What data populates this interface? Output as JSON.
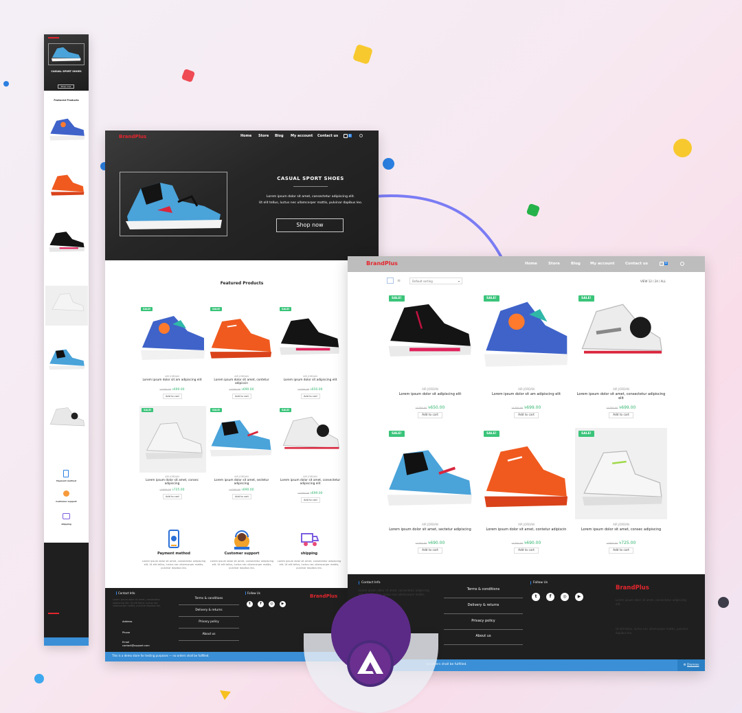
{
  "brand": {
    "name": "BrandPlus",
    "color": "#e4262d"
  },
  "nav": {
    "home": "Home",
    "store": "Store",
    "blog": "Blog",
    "account": "My account",
    "contact": "Contact us",
    "cart_count": "0"
  },
  "hero": {
    "title": "CASUAL SPORT SHOES",
    "line1": "Lorem ipsum dolor sit amet, consectetur adipiscing elit.",
    "line2": "Ut elit tellus, luctus nec ullamcorper mattis, pulvinar dapibus leo.",
    "cta": "Shop now"
  },
  "featured": {
    "title": "Featured Products",
    "sale": "SALE!",
    "products": [
      {
        "cat": "AIR JORDAN",
        "name": "Lorem ipsum dolor sit am adipiscing elit",
        "old": "৳1700.00",
        "new": "৳699.00",
        "add": "Add to cart"
      },
      {
        "cat": "AIR JORDAN",
        "name": "Lorem ipsum dolor sit amet, contetur adipiscin",
        "old": "৳1700.00",
        "new": "৳690.00",
        "add": "Add to cart"
      },
      {
        "cat": "AIR JORDAN",
        "name": "Lorem ipsum dolor sit adipiscing elit",
        "old": "৳1750.00",
        "new": "৳650.00",
        "add": "Add to cart"
      },
      {
        "cat": "AIR JORDAN",
        "name": "Lorem ipsum dolor sit amet, consec adipiscing",
        "old": "৳1800.00",
        "new": "৳725.00",
        "add": "Add to cart"
      },
      {
        "cat": "AIR JORDAN",
        "name": "Lorem ipsum dolor sit amet, sectetur adipiscing",
        "old": "৳1750.00",
        "new": "৳690.00",
        "add": "Add to cart"
      },
      {
        "cat": "AIR JORDAN",
        "name": "Lorem ipsum dolor sit amet, consectetur adipiscing elit",
        "old": "৳1700.00",
        "new": "৳699.00",
        "add": "Add to cart"
      }
    ]
  },
  "services": [
    {
      "name": "Payment method",
      "text": "Lorem ipsum dolor sit amet, consectetur adipiscing elit. Ut elit tellus, luctus nec ullamcorper mattis, pulvinar dapibus leo."
    },
    {
      "name": "Customer support",
      "text": "Lorem ipsum dolor sit amet, consectetur adipiscing elit. Ut elit tellus, luctus nec ullamcorper mattis, pulvinar dapibus leo."
    },
    {
      "name": "shipping",
      "text": "Lorem ipsum dolor sit amet, consectetur adipiscing elit. Ut elit tellus, luctus nec ullamcorper mattis, pulvinar dapibus leo."
    }
  ],
  "footer": {
    "contact_title": "Contact Info",
    "contact_text": "Lorem ipsum dolor sit amet, consectetur adipiscing elit. Ut elit tellus, luctus nec ullamcorper mattis, pulvinar dapibus leo.",
    "address_label": "Address",
    "phone_label": "Phone",
    "email_label": "Email",
    "email_value": "contact@support.com",
    "links": [
      "Terms & conditions",
      "Delivery & returns",
      "Privacy policy",
      "About us"
    ],
    "follow_title": "Follow Us",
    "brand_text_1": "Lorem ipsum dolor sit amet, consectetur adipiscing elit.",
    "brand_text_2": "Ut elit tellus, luctus nec ullamcorper mattis, pulvinar dapibus leo.",
    "notice": "This is a demo store for testing purposes — no orders shall be fulfilled.",
    "notice_tail": "no orders shall be fulfilled.",
    "dismiss": "Dismiss"
  },
  "store": {
    "sort": "Default sorting",
    "view_label": "VIEW",
    "view_opts": "12 / 24 / ALL",
    "sale": "SALE!",
    "products": [
      {
        "cat": "AIR JORDAN",
        "name": "Lorem ipsum dolor sit adipiscing elit",
        "old": "৳1750.00",
        "new": "৳650.00",
        "add": "Add to cart"
      },
      {
        "cat": "AIR JORDAN",
        "name": "Lorem ipsum dolor sit am adipiscing elit",
        "old": "৳1700.00",
        "new": "৳699.00",
        "add": "Add to cart"
      },
      {
        "cat": "AIR JORDAN",
        "name": "Lorem ipsum dolor sit amet, consectetur adipiscing elit",
        "old": "৳1700.00",
        "new": "৳699.00",
        "add": "Add to cart"
      },
      {
        "cat": "AIR JORDAN",
        "name": "Lorem ipsum dolor sit amet, sectetur adipiscing",
        "old": "৳1750.00",
        "new": "৳690.00",
        "add": "Add to cart"
      },
      {
        "cat": "AIR JORDAN",
        "name": "Lorem ipsum dolor sit amet, contetur adipiscin",
        "old": "৳1700.00",
        "new": "৳690.00",
        "add": "Add to cart"
      },
      {
        "cat": "AIR JORDAN",
        "name": "Lorem ipsum dolor sit amet, consec adipiscing",
        "old": "৳1800.00",
        "new": "৳725.00",
        "add": "Add to cart"
      }
    ]
  },
  "mobile": {
    "hero_title": "CASUAL SPORT SHOES",
    "cta": "Shop now",
    "featured": "Featured Products",
    "svc1": "Payment method",
    "svc2": "Customer support",
    "svc3": "shipping"
  },
  "colors": {
    "sale_badge": "#3ac47a",
    "price_new": "#2eb36b",
    "footer_bg": "#1f1f1f",
    "notice_bar": "#3a8fd6",
    "hero_bg": "#2a2a2a",
    "logo_purple": "#5b2a86"
  }
}
